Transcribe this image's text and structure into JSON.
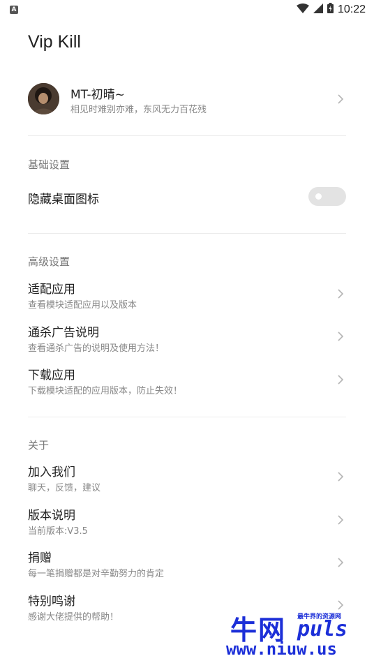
{
  "status_bar": {
    "notification_icon": "a-notification-icon",
    "time": "10:22"
  },
  "app": {
    "title": "Vip Kill"
  },
  "profile": {
    "name": "MT-初晴~",
    "subtitle": "相见时难别亦难，东风无力百花残"
  },
  "sections": {
    "basic": {
      "title": "基础设置",
      "hide_icon_label": "隐藏桌面图标",
      "hide_icon_enabled": false
    },
    "advanced": {
      "title": "高级设置",
      "items": [
        {
          "title": "适配应用",
          "subtitle": "查看模块适配应用以及版本"
        },
        {
          "title": "通杀广告说明",
          "subtitle": "查看通杀广告的说明及使用方法！"
        },
        {
          "title": "下载应用",
          "subtitle": "下载模块适配的应用版本，防止失效！"
        }
      ]
    },
    "about": {
      "title": "关于",
      "items": [
        {
          "title": "加入我们",
          "subtitle": "聊天，反馈，建议"
        },
        {
          "title": "版本说明",
          "subtitle": "当前版本:V3.5"
        },
        {
          "title": "捐赠",
          "subtitle": "每一笔捐赠都是对辛勤努力的肯定"
        },
        {
          "title": "特别鸣谢",
          "subtitle": "感谢大佬提供的帮助！"
        }
      ]
    }
  },
  "watermark": {
    "big": "牛网",
    "small": "最牛界的资源网",
    "brand": "puls",
    "url": "www.niuw.us"
  },
  "colors": {
    "watermark": "#1c2fd8",
    "divider": "#ececec",
    "toggle_off": "#e3e3e3"
  }
}
